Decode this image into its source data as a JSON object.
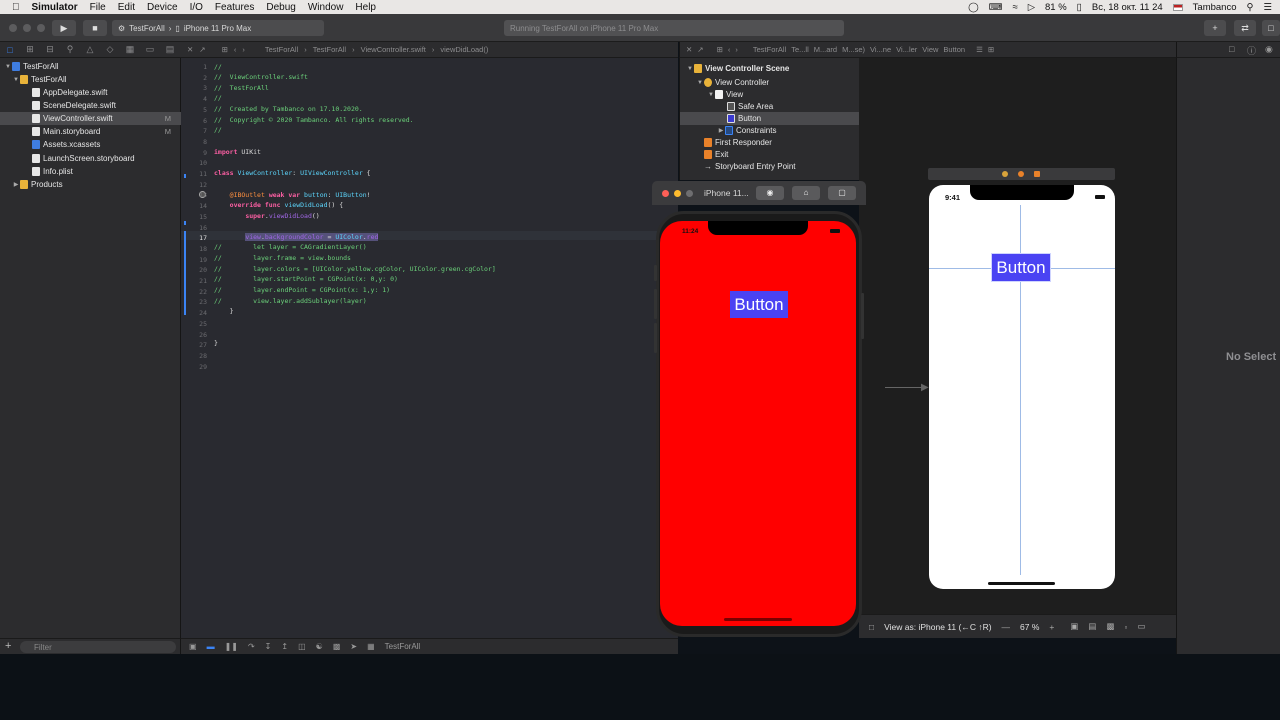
{
  "menubar": {
    "apple": "",
    "app_name": "Simulator",
    "menus": [
      "File",
      "Edit",
      "Device",
      "I/O",
      "Features",
      "Debug",
      "Window",
      "Help"
    ],
    "battery": "81 %",
    "datetime": "Вс, 18 окт. 11 24",
    "user": "Tambanco"
  },
  "toolbar": {
    "scheme": "TestForAll",
    "device": "iPhone 11 Pro Max",
    "activity": "Running TestForAll on iPhone 11 Pro Max"
  },
  "navigator": {
    "items": [
      {
        "label": "TestForAll",
        "badge": ""
      },
      {
        "label": "TestForAll",
        "badge": ""
      },
      {
        "label": "AppDelegate.swift",
        "badge": ""
      },
      {
        "label": "SceneDelegate.swift",
        "badge": ""
      },
      {
        "label": "ViewController.swift",
        "badge": "M"
      },
      {
        "label": "Main.storyboard",
        "badge": "M"
      },
      {
        "label": "Assets.xcassets",
        "badge": ""
      },
      {
        "label": "LaunchScreen.storyboard",
        "badge": ""
      },
      {
        "label": "Info.plist",
        "badge": ""
      },
      {
        "label": "Products",
        "badge": ""
      }
    ],
    "filter_placeholder": "Filter"
  },
  "editor": {
    "breadcrumb": [
      "TestForAll",
      "TestForAll",
      "ViewController.swift",
      "viewDidLoad()"
    ],
    "line_numbers": [
      "1",
      "2",
      "3",
      "4",
      "5",
      "6",
      "7",
      "8",
      "9",
      "10",
      "11",
      "12",
      "13",
      "14",
      "15",
      "16",
      "17",
      "18",
      "19",
      "20",
      "21",
      "22",
      "23",
      "24",
      "25",
      "26",
      "27",
      "28",
      "29"
    ],
    "current_line": "17"
  },
  "debugbar": {
    "target": "TestForAll"
  },
  "ib": {
    "breadcrumb": [
      "TestForAll",
      "Te...ll",
      "M...ard",
      "M...se)",
      "Vi...ne",
      "Vi...ler",
      "View",
      "Button"
    ],
    "outline": {
      "scene": "View Controller Scene",
      "controller": "View Controller",
      "view": "View",
      "safe_area": "Safe Area",
      "button": "Button",
      "constraints": "Constraints",
      "first_responder": "First Responder",
      "exit": "Exit",
      "entry_point": "Storyboard Entry Point"
    },
    "canvas_time": "9:41",
    "canvas_button": "Button",
    "view_as": "View as: iPhone 11 (←C ↑R)",
    "zoom": "67 %"
  },
  "inspector": {
    "empty": "No Select"
  },
  "simulator": {
    "title": "iPhone 11...",
    "time": "11:24",
    "button": "Button"
  }
}
